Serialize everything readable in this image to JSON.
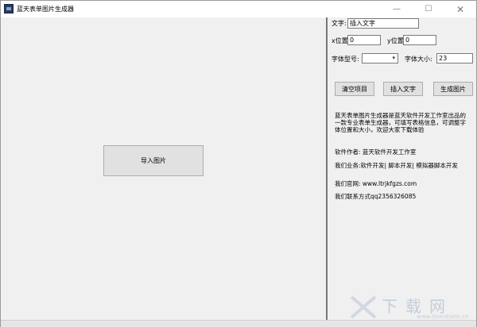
{
  "window": {
    "title": "蓝天表单图片生成器",
    "controls": {
      "minimize": "—",
      "maximize": "☐",
      "close": "✕"
    }
  },
  "left": {
    "import_button": "导入图片"
  },
  "right": {
    "text_label": "文字:",
    "text_value": "插入文字",
    "x_label": "x位置",
    "x_value": "0",
    "y_label": "y位置",
    "y_value": "0",
    "font_type_label": "字体型号:",
    "font_type_value": "",
    "font_size_label": "字体大小:",
    "font_size_value": "23",
    "buttons": {
      "clear": "清空项目",
      "insert": "插入文字",
      "generate": "生成图片"
    },
    "info": {
      "desc": "蓝天表单图片生成器是蓝天软件开发工作室出品的一款专业表单生成器，可填写表格信息，可调整字体位置和大小，欢迎大家下载体验",
      "author": "软件作者: 蓝天软件开发工作室",
      "business": "我们业务:软件开发| 脚本开发| 模拟器脚本开发",
      "website": "我们官网: www.ltrjkfgzs.com",
      "contact": "我们联系方式qq2356326085"
    }
  },
  "watermark": {
    "text": "下载网",
    "url": "www.downbank.cn"
  },
  "colors": {
    "window_bg": "#f0f0f0",
    "button_bg": "#e1e1e1",
    "divider": "#777777"
  }
}
